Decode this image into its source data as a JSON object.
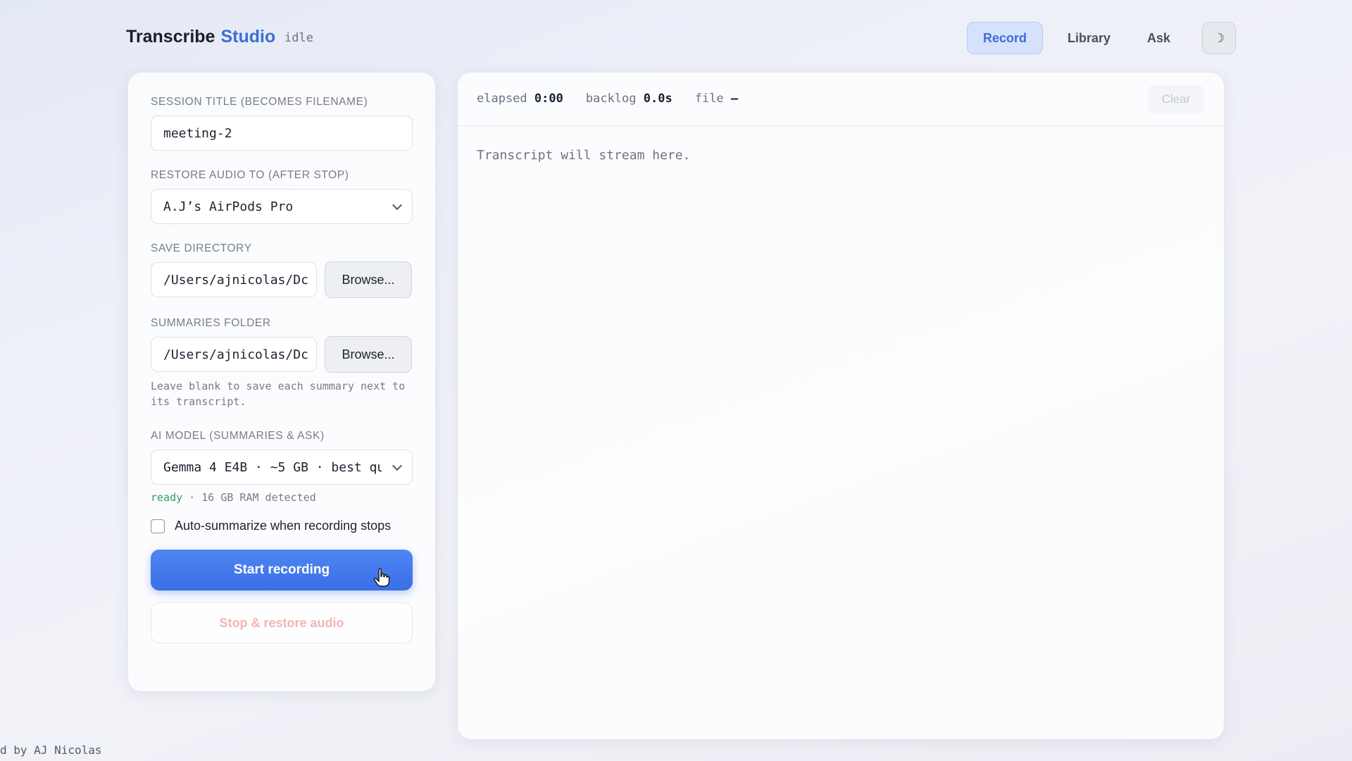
{
  "header": {
    "brand_main": "Transcribe",
    "brand_accent": "Studio",
    "status": "idle",
    "nav": {
      "record": "Record",
      "library": "Library",
      "ask": "Ask"
    },
    "theme_glyph": "☽"
  },
  "form": {
    "session_title": {
      "label": "Session title (becomes filename)",
      "value": "meeting-2"
    },
    "restore_audio": {
      "label": "Restore audio to (after stop)",
      "value": "A.J’s AirPods Pro"
    },
    "save_directory": {
      "label": "Save directory",
      "value": "/Users/ajnicolas/Dc",
      "browse": "Browse..."
    },
    "summaries_folder": {
      "label": "Summaries folder",
      "value": "/Users/ajnicolas/Dc",
      "browse": "Browse...",
      "hint": "Leave blank to save each summary next to its transcript."
    },
    "ai_model": {
      "label": "AI model (summaries & ask)",
      "value": "Gemma 4 E4B · ~5 GB · best qu",
      "status_ok": "ready",
      "status_rest": " · 16 GB RAM detected"
    },
    "auto_summarize": {
      "label": "Auto-summarize when recording stops",
      "checked": false
    },
    "start_label": "Start recording",
    "stop_label": "Stop & restore audio"
  },
  "transcript": {
    "elapsed_label": "elapsed",
    "elapsed_value": "0:00",
    "backlog_label": "backlog",
    "backlog_value": "0.0s",
    "file_label": "file",
    "file_value": "–",
    "clear_label": "Clear",
    "placeholder": "Transcript will stream here."
  },
  "footer": "d by AJ Nicolas",
  "colors": {
    "accent": "#3b6fd6",
    "primary_button": "#3a6fe6",
    "ready": "#2f9f5b",
    "stop_disabled": "#f2b5b5"
  }
}
